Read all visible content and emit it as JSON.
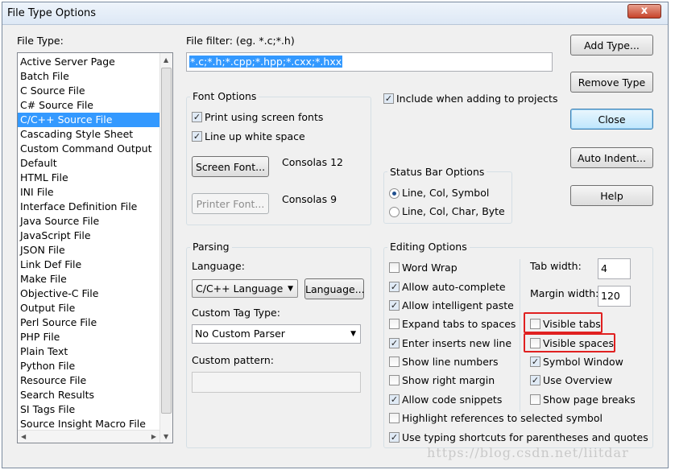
{
  "window": {
    "title": "File Type Options",
    "close_glyph": "x"
  },
  "file_type": {
    "label": "File Type:",
    "items": [
      "Active Server Page",
      "Batch File",
      "C Source File",
      "C# Source File",
      "C/C++ Source File",
      "Cascading Style Sheet",
      "Custom Command Output",
      "Default",
      "HTML File",
      "INI File",
      "Interface Definition File",
      "Java Source File",
      "JavaScript File",
      "JSON File",
      "Link Def File",
      "Make File",
      "Objective-C File",
      "Output File",
      "Perl Source File",
      "PHP File",
      "Plain Text",
      "Python File",
      "Resource File",
      "Search Results",
      "SI Tags File",
      "Source Insight Macro File"
    ],
    "selected": "C/C++ Source File"
  },
  "file_filter": {
    "label": "File filter: (eg. *.c;*.h)",
    "value": "*.c;*.h;*.cpp;*.hpp;*.cxx;*.hxx"
  },
  "buttons": {
    "add_type": "Add Type...",
    "remove_type": "Remove Type",
    "close": "Close",
    "auto_indent": "Auto Indent...",
    "help": "Help"
  },
  "include_projects": {
    "label": "Include when adding to projects",
    "checked": true
  },
  "font_options": {
    "title": "Font Options",
    "print_screen_fonts": "Print using screen fonts",
    "line_up_white_space": "Line up white space",
    "screen_font_button": "Screen Font...",
    "screen_font_value": "Consolas 12",
    "printer_font_button": "Printer Font...",
    "printer_font_value": "Consolas 9"
  },
  "status_bar": {
    "title": "Status Bar Options",
    "option1": "Line, Col, Symbol",
    "option2": "Line, Col, Char, Byte"
  },
  "parsing": {
    "title": "Parsing",
    "language_label": "Language:",
    "language_value": "C/C++ Language",
    "language_button": "Language...",
    "tag_type_label": "Custom Tag Type:",
    "tag_type_value": "No Custom Parser",
    "pattern_label": "Custom pattern:",
    "pattern_value": ""
  },
  "editing": {
    "title": "Editing Options",
    "word_wrap": "Word Wrap",
    "auto_complete": "Allow auto-complete",
    "intelligent_paste": "Allow intelligent paste",
    "expand_tabs": "Expand tabs to spaces",
    "enter_inserts": "Enter inserts new line",
    "show_line_numbers": "Show line numbers",
    "show_right_margin": "Show right margin",
    "code_snippets": "Allow code snippets",
    "highlight_refs": "Highlight references to selected symbol",
    "typing_shortcuts": "Use typing shortcuts for parentheses and quotes",
    "tab_width_label": "Tab width:",
    "tab_width_value": "4",
    "margin_width_label": "Margin width:",
    "margin_width_value": "120",
    "visible_tabs": "Visible tabs",
    "visible_spaces": "Visible spaces",
    "symbol_window": "Symbol Window",
    "use_overview": "Use Overview",
    "show_page_breaks": "Show page breaks"
  },
  "watermark": "https://blog.csdn.net/liitdar",
  "check_glyph": "✓",
  "highlight_color": "#e02020",
  "selection_color": "#3399ff"
}
